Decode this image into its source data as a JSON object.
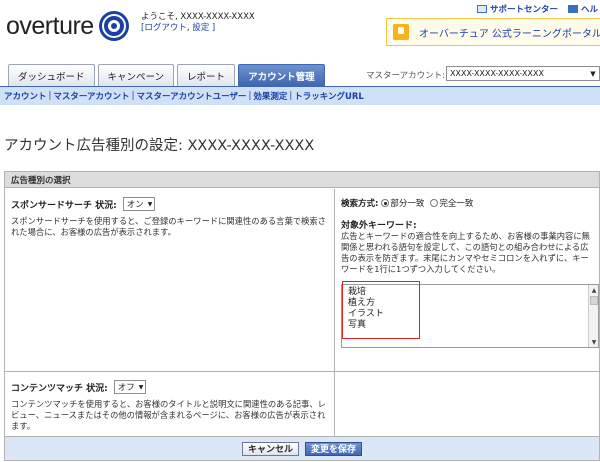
{
  "header": {
    "logo_text": "overture",
    "welcome_line1": "ようこそ, XXXX-XXXX-XXXX",
    "logout_link": "[ログアウト",
    "settings_link": "設定 ]",
    "top_links": {
      "support": "サポートセンター",
      "help": "ヘル"
    },
    "banner_text": "オーバーチュア 公式ラーニングポータル"
  },
  "tabs": [
    {
      "label": "ダッシュボード"
    },
    {
      "label": "キャンペーン"
    },
    {
      "label": "レポート"
    },
    {
      "label": "アカウント管理"
    }
  ],
  "master_account": {
    "label": "マスターアカウント:",
    "value": "XXXX-XXXX-XXXX-XXXX"
  },
  "subnav": [
    {
      "label": "アカウント"
    },
    {
      "label": "マスターアカウント"
    },
    {
      "label": "マスターアカウントユーザー"
    },
    {
      "label": "効果測定"
    },
    {
      "label": "トラッキングURL"
    }
  ],
  "page_title": "アカウント広告種別の設定: XXXX-XXXX-XXXX",
  "panel": {
    "header": "広告種別の選択",
    "sponsored": {
      "label": "スポンサードサーチ 状況:",
      "value": "オン",
      "description": "スポンサードサーチを使用すると、ご登録のキーワードに関連性のある言葉で検索された場合に、お客様の広告が表示されます。"
    },
    "match": {
      "label": "検索方式:",
      "option_partial": "部分一致",
      "option_exact": "完全一致"
    },
    "negative": {
      "title": "対象外キーワード:",
      "description": "広告とキーワードの適合性を向上するため、お客様の事業内容に無関係と思われる語句を設定して、この語句との組み合わせによる広告の表示を防ぎます。末尾にカンマやセミコロンを入れずに、キーワードを1行に1つずつ入力してください。",
      "keywords": [
        "栽培",
        "植え方",
        "イラスト",
        "写真"
      ]
    },
    "content": {
      "label": "コンテンツマッチ 状況:",
      "value": "オフ",
      "description": "コンテンツマッチを使用すると、お客様のタイトルと説明文に関連性のある記事、レビュー、ニュースまたはその他の情報が含まれるページに、お客様の広告が表示されます。"
    },
    "buttons": {
      "cancel": "キャンセル",
      "save": "変更を保存"
    }
  }
}
